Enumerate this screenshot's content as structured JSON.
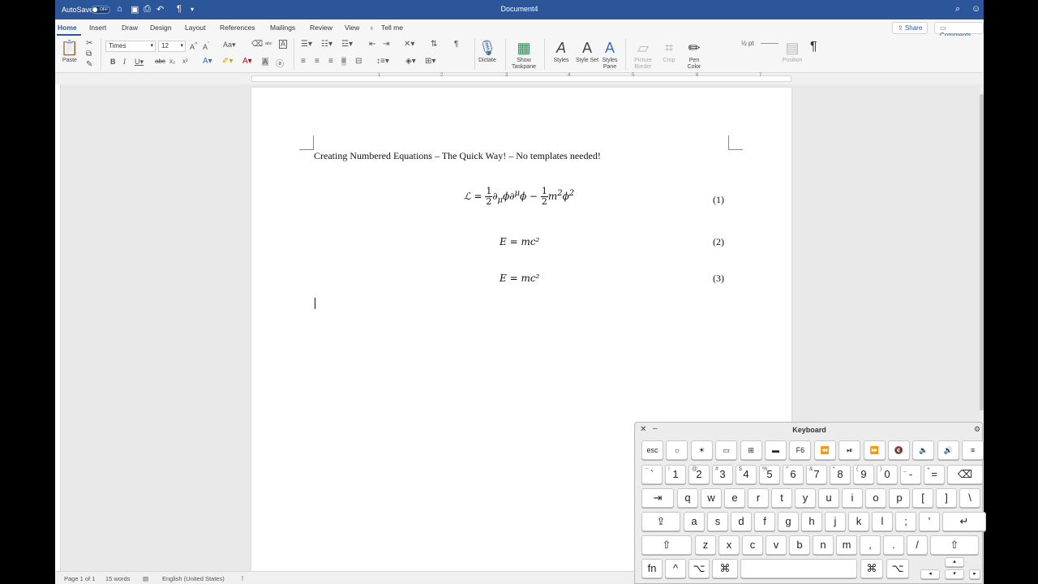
{
  "window": {
    "autosave_label": "AutoSave",
    "autosave_state": "OFF",
    "title": "Document4"
  },
  "tabs": {
    "items": [
      "Home",
      "Insert",
      "Draw",
      "Design",
      "Layout",
      "References",
      "Mailings",
      "Review",
      "View"
    ],
    "tell_me": "Tell me",
    "share": "Share",
    "comments": "Comments"
  },
  "ribbon": {
    "paste": "Paste",
    "font_name": "Times",
    "font_size": "12",
    "dictate": "Dictate",
    "show_taskpane": "Show Taskpane",
    "styles": "Styles",
    "style_set": "Style Set",
    "styles_pane": "Styles Pane",
    "picture_border": "Picture Border",
    "crop": "Crop",
    "pen_color": "Pen Color",
    "pen_weight": "½ pt",
    "position": "Position"
  },
  "ruler": {
    "numbers": [
      "1",
      "2",
      "3",
      "4",
      "5",
      "6",
      "7"
    ]
  },
  "document": {
    "heading": "Creating Numbered Equations – The Quick Way!  – No templates needed!",
    "equations": [
      {
        "number": "(1)"
      },
      {
        "text": "E = mc²",
        "number": "(2)"
      },
      {
        "text": "E = mc²",
        "number": "(3)"
      }
    ],
    "eq1": {
      "lhs": "ℒ = ",
      "frac_num": "1",
      "frac_den": "2",
      "mid": "∂",
      "mu_sub": "μ",
      "phi1": "ϕ∂",
      "mu_sup": "μ",
      "phi2": "ϕ − ",
      "m": "m",
      "two1": "2",
      "phi3": "ϕ",
      "two2": "2"
    }
  },
  "status": {
    "page": "Page 1 of 1",
    "words": "15 words",
    "language": "English (United States)"
  },
  "keyboard": {
    "title": "Keyboard",
    "fn_row": [
      "esc",
      "☼",
      "☀",
      "▭",
      "⊞",
      "▬",
      "F6",
      "⏪",
      "⏯",
      "⏩",
      "🔇",
      "🔈",
      "🔊",
      "≡"
    ],
    "num_row": [
      {
        "k": "`",
        "s": "~"
      },
      {
        "k": "1",
        "s": "!"
      },
      {
        "k": "2",
        "s": "@"
      },
      {
        "k": "3",
        "s": "#"
      },
      {
        "k": "4",
        "s": "$"
      },
      {
        "k": "5",
        "s": "%"
      },
      {
        "k": "6",
        "s": "^"
      },
      {
        "k": "7",
        "s": "&"
      },
      {
        "k": "8",
        "s": "*"
      },
      {
        "k": "9",
        "s": "("
      },
      {
        "k": "0",
        "s": ")"
      },
      {
        "k": "-",
        "s": "_"
      },
      {
        "k": "=",
        "s": "+"
      },
      {
        "k": "⌫",
        "s": ""
      }
    ],
    "q_row": [
      "⇥",
      "q",
      "w",
      "e",
      "r",
      "t",
      "y",
      "u",
      "i",
      "o",
      "p",
      "[",
      "]",
      "\\"
    ],
    "a_row": [
      "⇪",
      "a",
      "s",
      "d",
      "f",
      "g",
      "h",
      "j",
      "k",
      "l",
      ";",
      "'",
      "↵"
    ],
    "z_row": [
      "⇧",
      "z",
      "x",
      "c",
      "v",
      "b",
      "n",
      "m",
      ",",
      ".",
      "/",
      "⇧"
    ],
    "bottom_row": [
      "fn",
      "^",
      "⌥",
      "⌘",
      "",
      "⌘",
      "⌥"
    ]
  },
  "colors": {
    "title_bar": "#2b579a",
    "accent": "#2b579a"
  }
}
